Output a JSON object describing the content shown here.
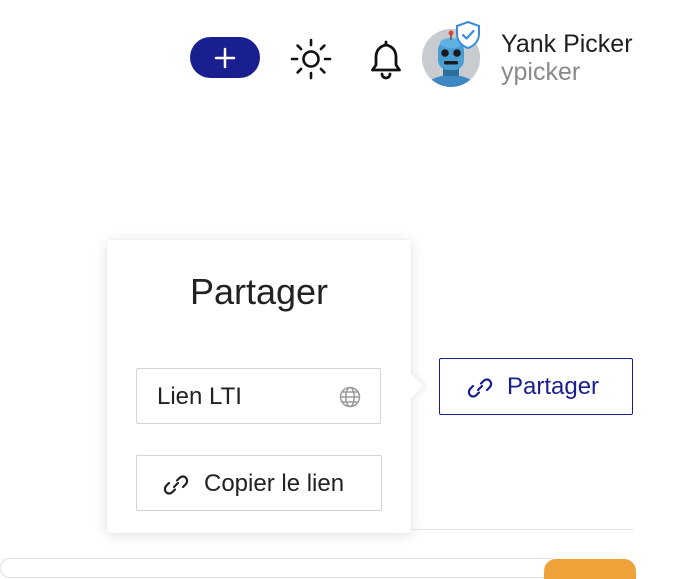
{
  "header": {
    "add_button_label": "+",
    "icons": {
      "add": "plus-icon",
      "theme": "sun-icon",
      "notifications": "bell-icon",
      "verified": "verified-shield-icon"
    },
    "user": {
      "name": "Yank Picker",
      "handle": "ypicker"
    }
  },
  "popover": {
    "title": "Partager",
    "lti_field_label": "Lien LTI",
    "copy_button_label": "Copier le lien"
  },
  "share_button": {
    "label": "Partager"
  },
  "colors": {
    "primary": "#1a1f8f",
    "badge": "#3a8be0",
    "accent_orange": "#f0a23a"
  }
}
